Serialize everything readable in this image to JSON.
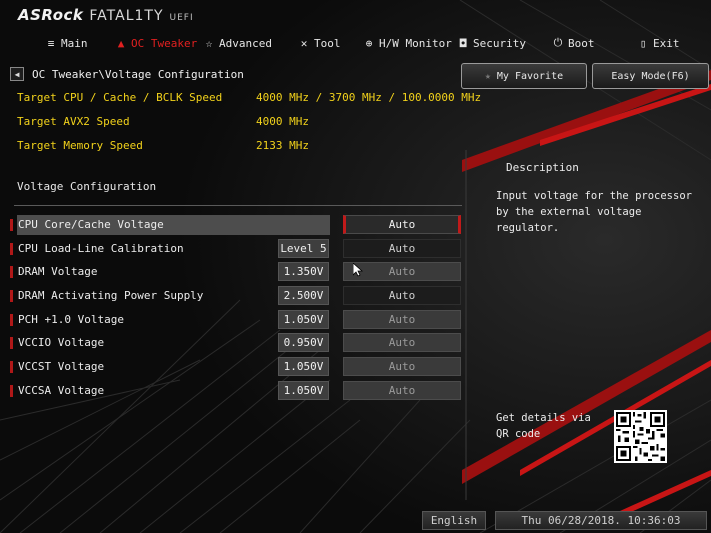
{
  "brand": {
    "name": "ASRock",
    "product": "FATAL1TY",
    "suffix": "UEFI"
  },
  "nav": {
    "tabs": [
      {
        "label": "Main",
        "icon": "list-icon"
      },
      {
        "label": "OC Tweaker",
        "icon": "flame-icon",
        "active": true
      },
      {
        "label": "Advanced",
        "icon": "star-icon"
      },
      {
        "label": "Tool",
        "icon": "tools-icon"
      },
      {
        "label": "H/W Monitor",
        "icon": "monitor-icon"
      },
      {
        "label": "Security",
        "icon": "shield-icon"
      },
      {
        "label": "Boot",
        "icon": "power-icon"
      },
      {
        "label": "Exit",
        "icon": "exit-icon"
      }
    ]
  },
  "breadcrumb": "OC Tweaker\\Voltage Configuration",
  "header_buttons": {
    "favorite": "My Favorite",
    "easy_mode": "Easy Mode(F6)"
  },
  "targets": [
    {
      "label": "Target CPU / Cache / BCLK Speed",
      "value": "4000 MHz / 3700 MHz / 100.0000 MHz"
    },
    {
      "label": "Target AVX2 Speed",
      "value": "4000 MHz"
    },
    {
      "label": "Target Memory Speed",
      "value": "2133 MHz"
    }
  ],
  "section_title": "Voltage Configuration",
  "voltages": [
    {
      "label": "CPU Core/Cache Voltage",
      "value": "",
      "option": "Auto",
      "selected": true,
      "dim": false
    },
    {
      "label": "CPU Load-Line Calibration",
      "value": "Level 5",
      "option": "Auto",
      "dim": false
    },
    {
      "label": "DRAM Voltage",
      "value": "1.350V",
      "option": "Auto",
      "dim": true
    },
    {
      "label": "DRAM Activating Power Supply",
      "value": "2.500V",
      "option": "Auto",
      "dim": false
    },
    {
      "label": "PCH +1.0 Voltage",
      "value": "1.050V",
      "option": "Auto",
      "dim": true
    },
    {
      "label": "VCCIO Voltage",
      "value": "0.950V",
      "option": "Auto",
      "dim": true
    },
    {
      "label": "VCCST Voltage",
      "value": "1.050V",
      "option": "Auto",
      "dim": true
    },
    {
      "label": "VCCSA Voltage",
      "value": "1.050V",
      "option": "Auto",
      "dim": true
    }
  ],
  "description": {
    "title": "Description",
    "text": "Input voltage for the processor by the external voltage regulator.",
    "qr_text": "Get details via QR code"
  },
  "footer": {
    "language": "English",
    "datetime": "Thu 06/28/2018. 10:36:03"
  },
  "colors": {
    "accent": "#e02020",
    "target_text": "#f2d21b"
  }
}
